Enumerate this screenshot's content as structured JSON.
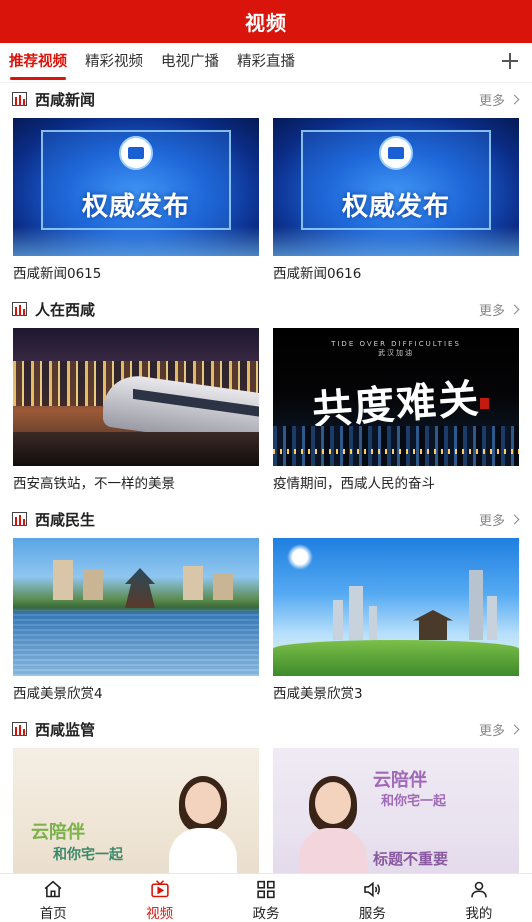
{
  "header": {
    "title": "视频"
  },
  "tabs": [
    {
      "label": "推荐视频",
      "active": true
    },
    {
      "label": "精彩视频",
      "active": false
    },
    {
      "label": "电视广播",
      "active": false
    },
    {
      "label": "精彩直播",
      "active": false
    }
  ],
  "more_label": "更多",
  "sections": [
    {
      "title": "西咸新闻",
      "items": [
        {
          "caption": "西咸新闻0615",
          "thumb_text": "权威发布"
        },
        {
          "caption": "西咸新闻0616",
          "thumb_text": "权威发布"
        }
      ]
    },
    {
      "title": "人在西咸",
      "items": [
        {
          "caption": "西安高铁站，不一样的美景"
        },
        {
          "caption": "疫情期间，西咸人民的奋斗",
          "thumb_small": "TIDE OVER DIFFICULTIES",
          "thumb_sub": "武汉加油",
          "thumb_text": "共度难关"
        }
      ]
    },
    {
      "title": "西咸民生",
      "items": [
        {
          "caption": "西咸美景欣赏4"
        },
        {
          "caption": "西咸美景欣赏3"
        }
      ]
    },
    {
      "title": "西咸监管",
      "items": [
        {
          "caption": "",
          "thumb_text": "云陪伴",
          "thumb_sub": "和你宅一起"
        },
        {
          "caption": "",
          "thumb_text": "云陪伴",
          "thumb_sub": "和你宅一起",
          "thumb_extra": "标题不重要"
        }
      ]
    }
  ],
  "bottom_nav": [
    {
      "label": "首页",
      "icon": "home-icon",
      "active": false
    },
    {
      "label": "视频",
      "icon": "video-icon",
      "active": true
    },
    {
      "label": "政务",
      "icon": "grid-icon",
      "active": false
    },
    {
      "label": "服务",
      "icon": "speaker-icon",
      "active": false
    },
    {
      "label": "我的",
      "icon": "user-icon",
      "active": false
    }
  ],
  "colors": {
    "brand": "#d9150b",
    "text": "#222222",
    "muted": "#888888"
  }
}
